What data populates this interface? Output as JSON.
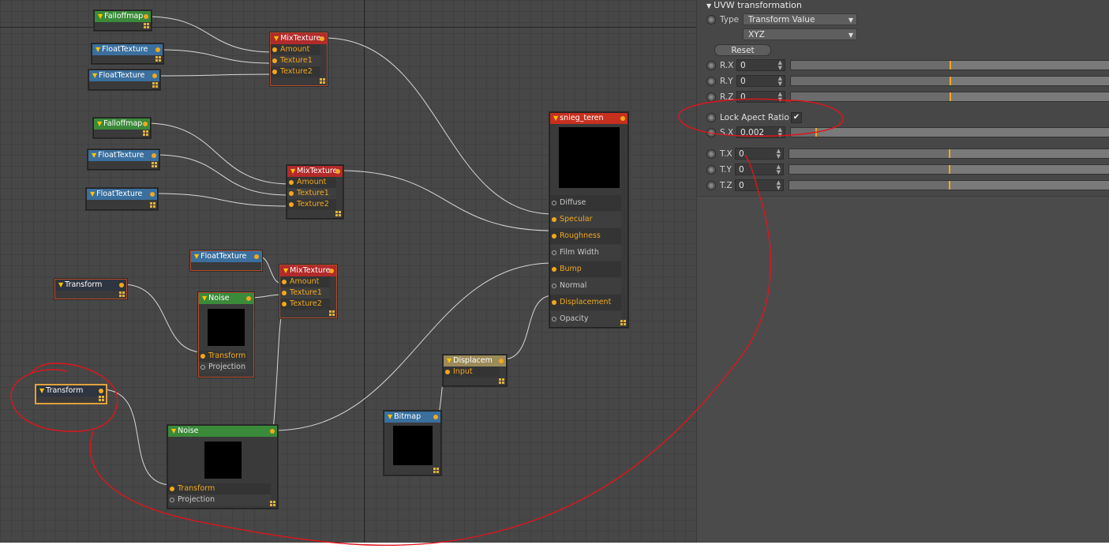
{
  "nodes": {
    "falloff1": {
      "title": "Falloffmap"
    },
    "float1": {
      "title": "FloatTexture"
    },
    "float2": {
      "title": "FloatTexture"
    },
    "mix1": {
      "title": "MixTexture",
      "ports": [
        "Amount",
        "Texture1",
        "Texture2"
      ]
    },
    "falloff2": {
      "title": "Falloffmap"
    },
    "float3": {
      "title": "FloatTexture"
    },
    "float4": {
      "title": "FloatTexture"
    },
    "mix2": {
      "title": "MixTexture",
      "ports": [
        "Amount",
        "Texture1",
        "Texture2"
      ]
    },
    "float5": {
      "title": "FloatTexture"
    },
    "mix3": {
      "title": "MixTexture",
      "ports": [
        "Amount",
        "Texture1",
        "Texture2"
      ]
    },
    "transform1": {
      "title": "Transform"
    },
    "noise1": {
      "title": "Noise",
      "ports": [
        "Transform",
        "Projection"
      ]
    },
    "transform2": {
      "title": "Transform"
    },
    "noise2": {
      "title": "Noise",
      "ports": [
        "Transform",
        "Projection"
      ]
    },
    "material": {
      "title": "snieg_teren",
      "ports": [
        "Diffuse",
        "Specular",
        "Roughness",
        "Film Width",
        "Bump",
        "Normal",
        "Displacement",
        "Opacity"
      ]
    },
    "displace": {
      "title": "Displacem",
      "ports": [
        "Input"
      ]
    },
    "bitmap": {
      "title": "Bitmap"
    }
  },
  "panel": {
    "section_title": "UVW transformation",
    "type_label": "Type",
    "type_value": "Transform Value",
    "order_value": "XYZ",
    "reset_label": "Reset",
    "rows": [
      {
        "label": "R.X",
        "value": "0",
        "level": 0.5
      },
      {
        "label": "R.Y",
        "value": "0",
        "level": 0.5
      },
      {
        "label": "R.Z",
        "value": "0",
        "level": 0.5
      }
    ],
    "lock_label": "Lock Apect Ratio",
    "lock_checked": "✔",
    "scale": {
      "label": "S.X",
      "value": "0.002",
      "level": 0.08
    },
    "trows": [
      {
        "label": "T.X",
        "value": "0",
        "level": 0.5
      },
      {
        "label": "T.Y",
        "value": "0",
        "level": 0.5
      },
      {
        "label": "T.Z",
        "value": "0",
        "level": 0.5
      }
    ]
  },
  "colors": {
    "port": "#f2a81d",
    "annotation": "#e0141c",
    "node_green": "#3a8a3a",
    "node_blue": "#3a6f9e",
    "node_red": "#b22a2a"
  }
}
